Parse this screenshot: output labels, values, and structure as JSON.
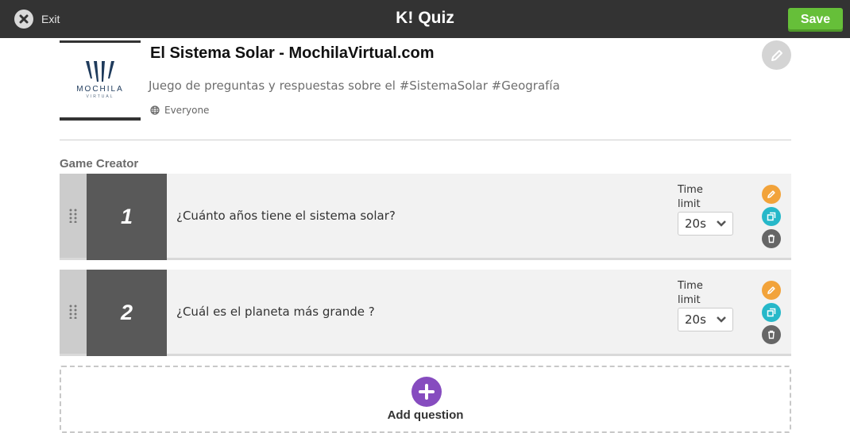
{
  "topbar": {
    "exit_label": "Exit",
    "brand_logo": "K!",
    "brand_label": "Quiz",
    "save_label": "Save",
    "colors": {
      "bar": "#333333",
      "save": "#66bf39"
    }
  },
  "header": {
    "cover_word": "MOCHILA",
    "cover_sub": "VIRTUAL",
    "title": "El Sistema Solar - MochilaVirtual.com",
    "description": "Juego de preguntas y respuestas sobre el #SistemaSolar #Geografía",
    "visibility": "Everyone",
    "visibility_icon": "globe-icon",
    "edit_icon": "pencil-icon"
  },
  "game_creator": {
    "title": "Game Creator",
    "time_limit_label": [
      "Time",
      "limit"
    ],
    "questions": [
      {
        "number": "1",
        "text": "¿Cuánto años tiene el sistema solar?",
        "time_limit": "20s"
      },
      {
        "number": "2",
        "text": "¿Cuál es el planeta más grande ?",
        "time_limit": "20s"
      }
    ],
    "actions": {
      "edit_color": "#f2a33a",
      "duplicate_color": "#26b8c9",
      "delete_color": "#666666"
    }
  },
  "add_question": {
    "label": "Add question",
    "icon": "plus-icon",
    "color": "#864cbf"
  }
}
